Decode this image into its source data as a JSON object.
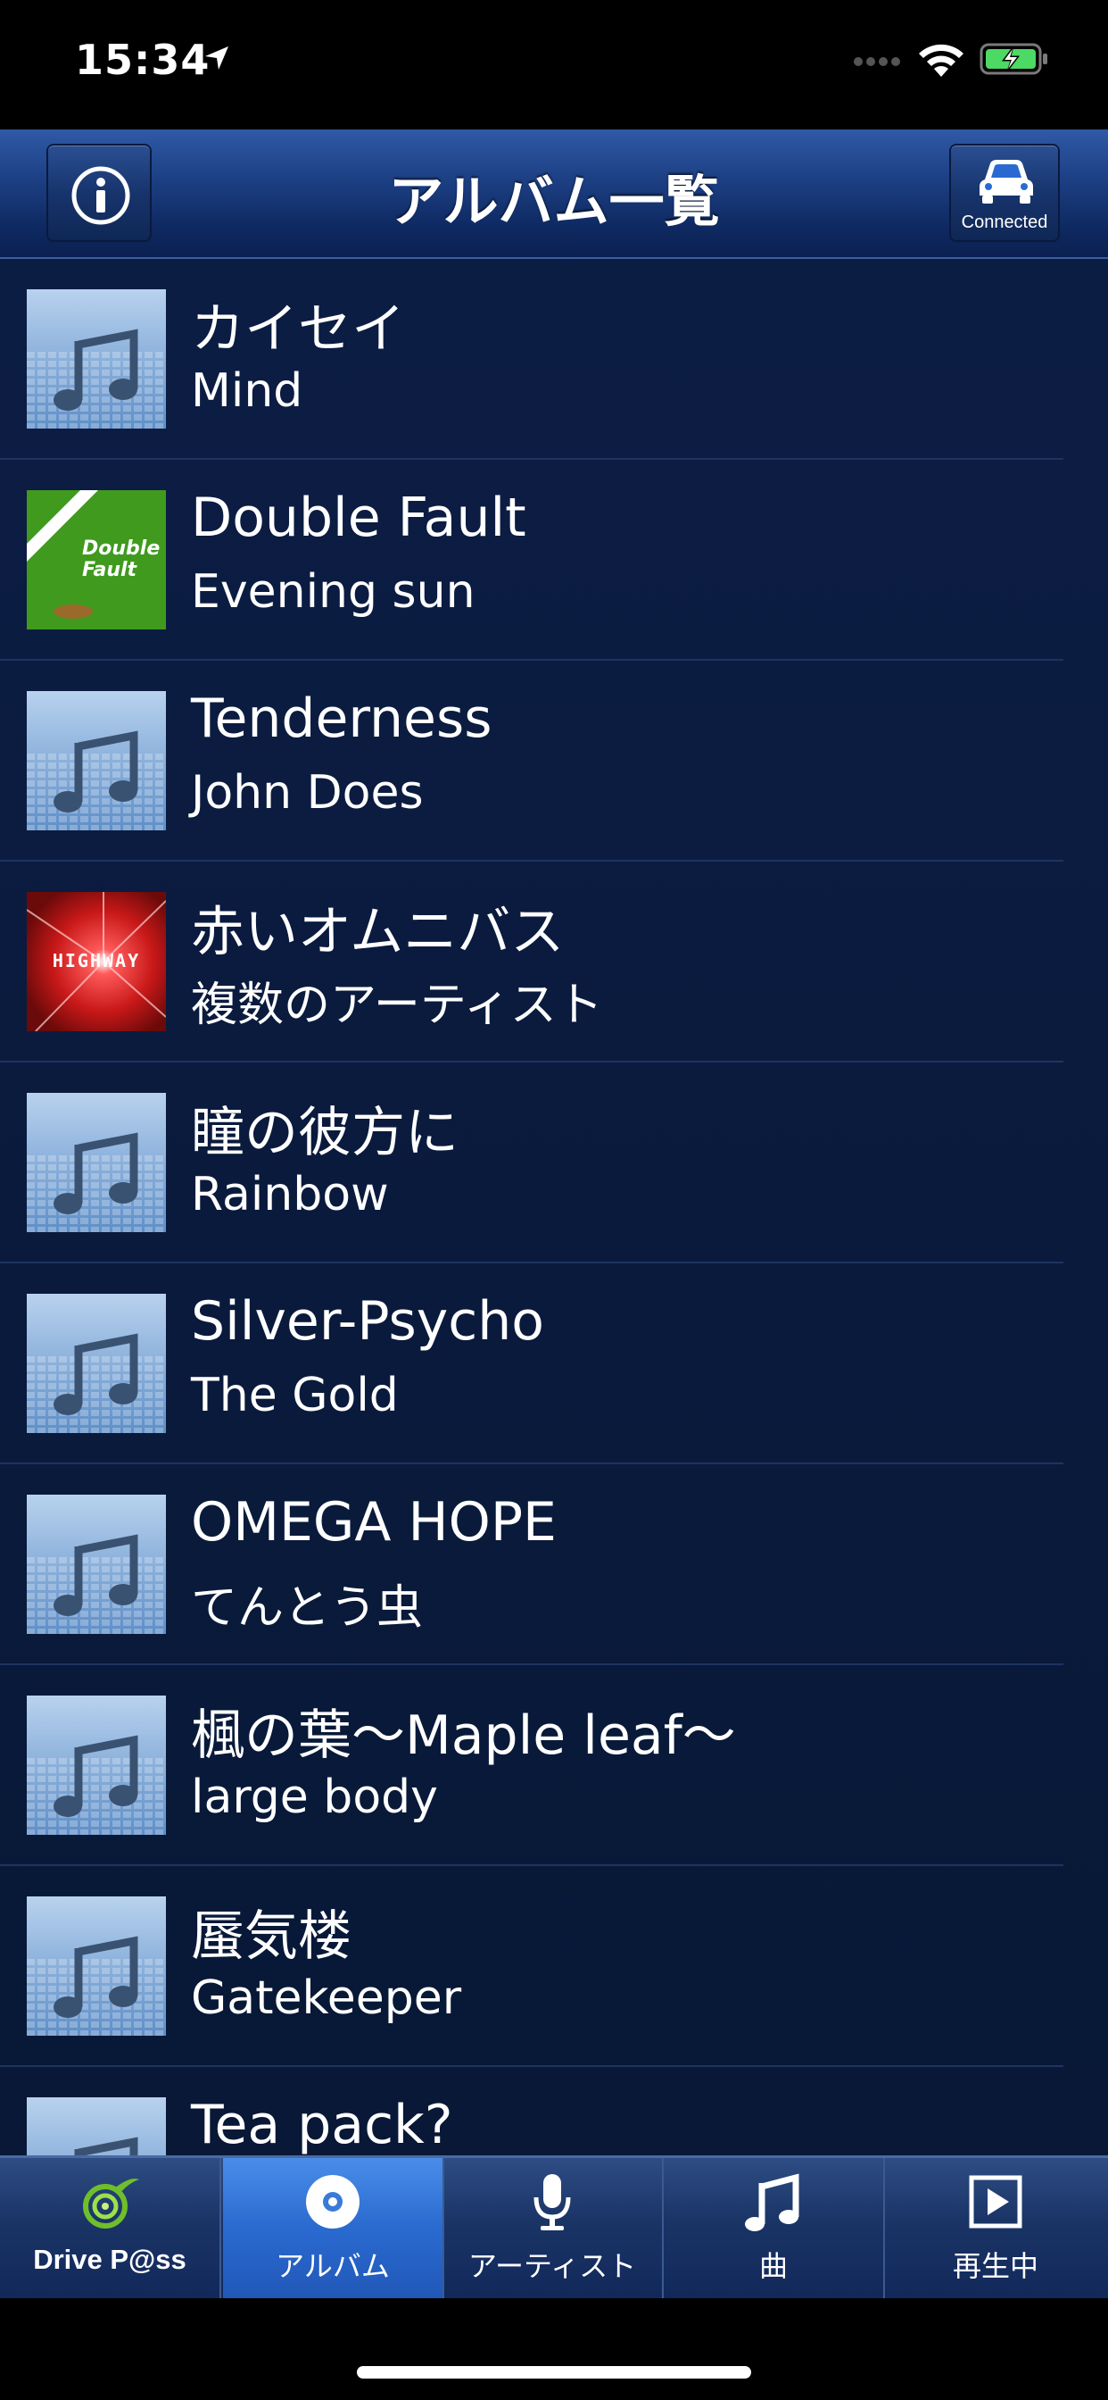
{
  "status_bar": {
    "time": "15:34"
  },
  "header": {
    "title": "アルバム一覧",
    "connected_label": "Connected"
  },
  "albums": [
    {
      "title": "カイセイ",
      "artist": "Mind",
      "art": "music-note-art"
    },
    {
      "title": "Double Fault",
      "artist": "Evening sun",
      "art": "double-fault-art",
      "art_text_1": "Double",
      "art_text_2": "Fault"
    },
    {
      "title": "Tenderness",
      "artist": "John Does",
      "art": "music-note-art"
    },
    {
      "title": "赤いオムニバス",
      "artist": "複数のアーティスト",
      "art": "highway-art",
      "art_text": "HIGHWAY"
    },
    {
      "title": "瞳の彼方に",
      "artist": "Rainbow",
      "art": "music-note-art"
    },
    {
      "title": "Silver-Psycho",
      "artist": "The Gold",
      "art": "music-note-art"
    },
    {
      "title": "OMEGA HOPE",
      "artist": "てんとう虫",
      "art": "music-note-art"
    },
    {
      "title": "楓の葉～Maple leaf～",
      "artist": "large body",
      "art": "music-note-art"
    },
    {
      "title": "蜃気楼",
      "artist": "Gatekeeper",
      "art": "music-note-art"
    },
    {
      "title": "Tea pack?",
      "artist": "",
      "art": "music-note-art"
    }
  ],
  "tabs": [
    {
      "label": "Drive P@ss",
      "icon": "drivepass-logo-icon",
      "active": false
    },
    {
      "label": "アルバム",
      "icon": "disc-icon",
      "active": true
    },
    {
      "label": "アーティスト",
      "icon": "microphone-icon",
      "active": false
    },
    {
      "label": "曲",
      "icon": "music-note-icon",
      "active": false
    },
    {
      "label": "再生中",
      "icon": "play-icon",
      "active": false
    }
  ],
  "colors": {
    "nav_bg": "#1c3f83",
    "list_bg": "#0c1d44",
    "active_tab": "#2a6ad0"
  }
}
